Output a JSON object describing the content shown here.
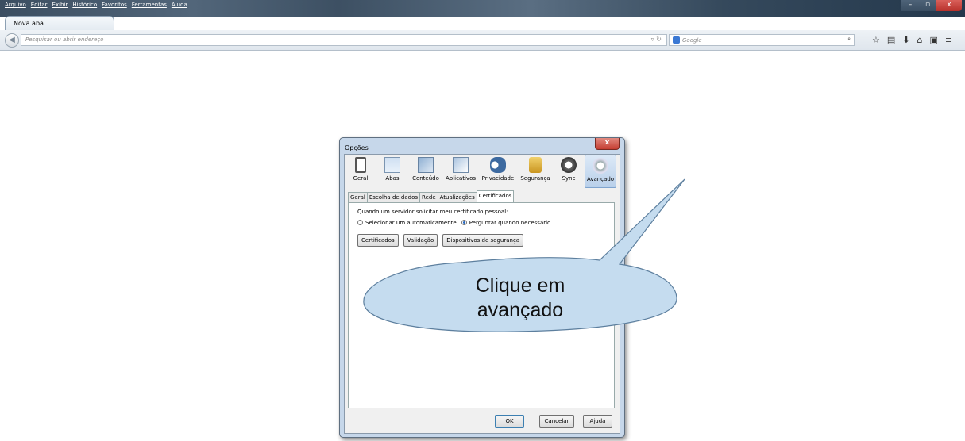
{
  "browser": {
    "menu": [
      "Arquivo",
      "Editar",
      "Exibir",
      "Histórico",
      "Favoritos",
      "Ferramentas",
      "Ajuda"
    ],
    "tab_title": "Nova aba",
    "new_tab": "+",
    "url_placeholder": "Pesquisar ou abrir endereço",
    "search_placeholder": "Google",
    "win_min": "–",
    "win_max": "▫",
    "win_close": "x"
  },
  "dialog": {
    "title": "Opções",
    "close": "x",
    "prefs": [
      {
        "label": "Geral",
        "icon": "general-icon"
      },
      {
        "label": "Abas",
        "icon": "tabs-icon"
      },
      {
        "label": "Conteúdo",
        "icon": "content-icon"
      },
      {
        "label": "Aplicativos",
        "icon": "applications-icon"
      },
      {
        "label": "Privacidade",
        "icon": "privacy-mask-icon"
      },
      {
        "label": "Segurança",
        "icon": "padlock-icon"
      },
      {
        "label": "Sync",
        "icon": "sync-icon"
      },
      {
        "label": "Avançado",
        "icon": "gear-icon"
      }
    ],
    "active_pref": "Avançado",
    "tabs": [
      "Geral",
      "Escolha de dados",
      "Rede",
      "Atualizações",
      "Certificados"
    ],
    "selected_tab": "Certificados",
    "question": "Quando um servidor solicitar meu certificado pessoal:",
    "radio_auto": "Selecionar um automaticamente",
    "radio_ask": "Perguntar quando necessário",
    "selected_radio": "Perguntar quando necessário",
    "btn_certificados": "Certificados",
    "btn_validacao": "Validação",
    "btn_dispositivos": "Dispositivos de segurança",
    "btn_ok": "OK",
    "btn_cancelar": "Cancelar",
    "btn_ajuda": "Ajuda"
  },
  "callout": {
    "line1": "Clique em",
    "line2": "avançado",
    "fill_color": "#c5dcef"
  }
}
